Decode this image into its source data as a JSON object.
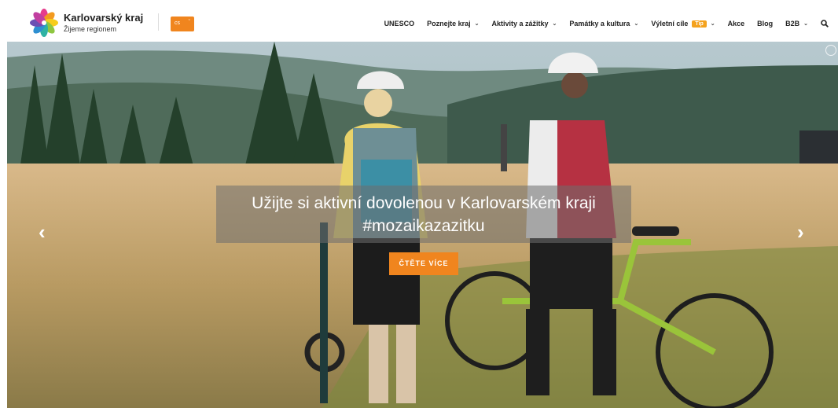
{
  "brand": {
    "title": "Karlovarský kraj",
    "subtitle": "Žijeme regionem"
  },
  "language": {
    "current": "cs",
    "caret": "ˇ"
  },
  "nav": {
    "items": [
      {
        "label": "UNESCO",
        "has_dropdown": false
      },
      {
        "label": "Poznejte kraj",
        "has_dropdown": true
      },
      {
        "label": "Aktivity a zážitky",
        "has_dropdown": true
      },
      {
        "label": "Památky a kultura",
        "has_dropdown": true
      },
      {
        "label": "Výletní cíle",
        "has_dropdown": true,
        "badge": "Tip"
      },
      {
        "label": "Akce",
        "has_dropdown": false
      },
      {
        "label": "Blog",
        "has_dropdown": false
      },
      {
        "label": "B2B",
        "has_dropdown": true
      }
    ],
    "chevron": "⌄"
  },
  "hero": {
    "caption_line1": "Užijte si aktivní dovolenou v Karlovarském kraji",
    "caption_line2": "#mozaikazazitku",
    "cta_label": "ČTĚTE VÍCE",
    "prev_arrow": "‹",
    "next_arrow": "›"
  },
  "colors": {
    "accent": "#f0851e",
    "tip_badge": "#f4a21e"
  },
  "icons": {
    "logo": "flower-logo-icon",
    "search": "search-icon",
    "expand": "expand-icon"
  }
}
